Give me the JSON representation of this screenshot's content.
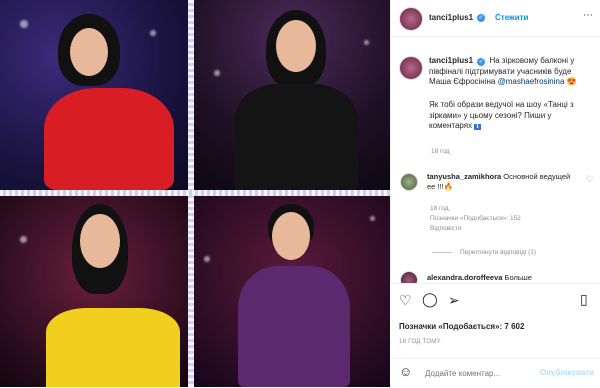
{
  "post": {
    "username": "tanci1plus1",
    "follow_label": "Стежити",
    "caption_text": "На зірковому балконі у півфіналі підтримувати учасників буде Маша Єфросініна ",
    "caption_mention": "@mashaefrosinina",
    "caption_emoji": "😍",
    "caption_question": "Як тобі образи ведучої на шоу «Танці з зірками» у цьому сезоні? Пиши у коментарях",
    "caption_emoji2": "ℹ",
    "caption_time": "18 год"
  },
  "comment": {
    "username": "tanyusha_zamikhora",
    "text": "Основной ведущей ее !!!🔥",
    "time": "18 год.",
    "likes": "Позначки «Подобається»: 152",
    "reply": "Відповісти",
    "view_replies": "Переглянути відповіді (1)"
  },
  "next_comment": {
    "username": "alexandra.doroffeeva",
    "text": "Больше"
  },
  "actions": {
    "likes_label": "Позначки «Подобається»: 7 602",
    "time_ago": "18 ГОД ТОМУ",
    "comment_placeholder": "Додайте коментар...",
    "publish_label": "Опублікувати"
  },
  "icons": {
    "like": "heart-icon",
    "comment": "comment-icon",
    "share": "share-icon",
    "save": "bookmark-icon",
    "emoji": "smiley-icon",
    "more": "more-icon"
  },
  "colors": {
    "link": "#0095f6",
    "mention": "#00376b",
    "verified": "#3897f0"
  }
}
